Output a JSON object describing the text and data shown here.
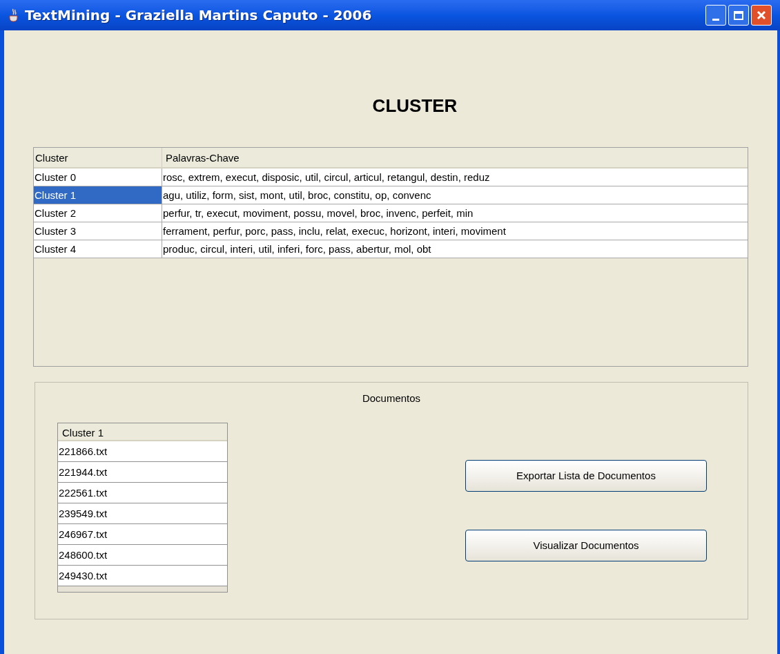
{
  "window": {
    "title": "TextMining - Graziella Martins Caputo - 2006"
  },
  "heading": "CLUSTER",
  "cluster_table": {
    "columns": [
      "Cluster",
      "Palavras-Chave"
    ],
    "rows": [
      {
        "cluster": "Cluster 0",
        "keywords": "rosc, extrem, execut, disposic, util, circul, articul, retangul, destin, reduz",
        "selected": false
      },
      {
        "cluster": "Cluster 1",
        "keywords": "agu, utiliz, form, sist, mont, util, broc, constitu, op, convenc",
        "selected": true
      },
      {
        "cluster": "Cluster 2",
        "keywords": "perfur, tr, execut, moviment, possu, movel, broc, invenc, perfeit, min",
        "selected": false
      },
      {
        "cluster": "Cluster 3",
        "keywords": "ferrament, perfur, porc, pass, inclu, relat, execuc, horizont, interi, moviment",
        "selected": false
      },
      {
        "cluster": "Cluster 4",
        "keywords": "produc, circul, interi, util, inferi, forc, pass, abertur, mol, obt",
        "selected": false
      }
    ]
  },
  "documents": {
    "title": "Documentos",
    "table": {
      "column": "Cluster 1",
      "rows": [
        "221866.txt",
        "221944.txt",
        "222561.txt",
        "239549.txt",
        "246967.txt",
        "248600.txt",
        "249430.txt"
      ]
    },
    "buttons": [
      "Exportar Lista de Documentos",
      "Visualizar Documentos"
    ]
  }
}
